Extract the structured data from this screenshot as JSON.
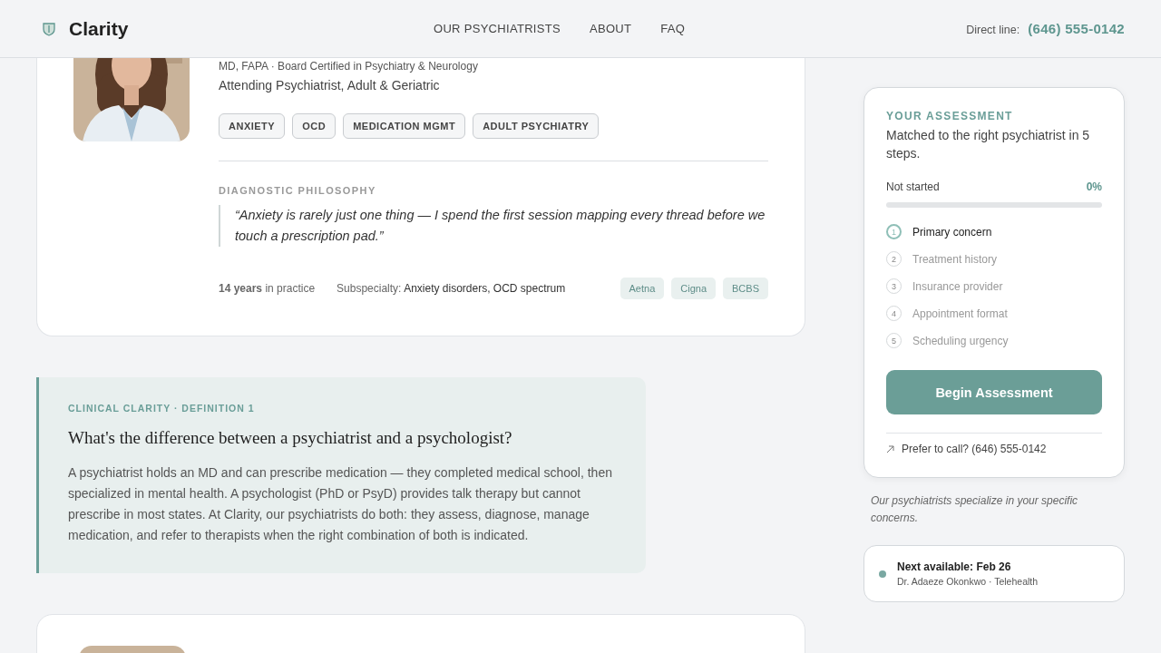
{
  "header": {
    "brand": "Clarity",
    "nav": [
      {
        "label": "OUR PSYCHIATRISTS"
      },
      {
        "label": "ABOUT"
      },
      {
        "label": "FAQ"
      }
    ],
    "direct_line_label": "Direct line:",
    "direct_line_phone": "(646) 555-0142"
  },
  "doctor": {
    "photo": {
      "kind": "picture"
    },
    "credentials": "MD, FAPA · Board Certified in Psychiatry & Neurology",
    "role": "Attending Psychiatrist, Adult & Geriatric",
    "tags": [
      "ANXIETY",
      "OCD",
      "MEDICATION MGMT",
      "ADULT PSYCHIATRY"
    ],
    "philosophy_label": "DIAGNOSTIC PHILOSOPHY",
    "quote": "“Anxiety is rarely just one thing — I spend the first session mapping every thread before we touch a prescription pad.”",
    "experience": "**14 years** in practice",
    "subspecialty_label": "Subspecialty:",
    "subspecialty": "Anxiety disorders, OCD spectrum",
    "insurers": [
      "Aetna",
      "Cigna",
      "BCBS"
    ]
  },
  "definition": {
    "eyebrow": "CLINICAL CLARITY · DEFINITION 1",
    "question": "What's the difference between a psychiatrist and a psychologist?",
    "answer": "A psychiatrist holds an MD and can prescribe medication — they completed medical school, then specialized in mental health. A psychologist (PhD or PsyD) provides talk therapy but cannot prescribe in most states. At Clarity, our psychiatrists do both: they assess, diagnose, manage medication, and refer to therapists when the right combination of both is indicated."
  },
  "next_doctor": {
    "photo": {
      "kind": "picture"
    }
  },
  "assessment": {
    "eyebrow": "YOUR ASSESSMENT",
    "subtitle": "Matched to the right psychiatrist in 5 steps.",
    "status": "Not started",
    "percent": "0%",
    "level": 0,
    "steps": [
      {
        "number": "1",
        "label": "Primary concern",
        "active": true
      },
      {
        "number": "2",
        "label": "Treatment history",
        "active": false
      },
      {
        "number": "3",
        "label": "Insurance provider",
        "active": false
      },
      {
        "number": "4",
        "label": "Appointment format",
        "active": false
      },
      {
        "number": "5",
        "label": "Scheduling urgency",
        "active": false
      }
    ],
    "button": "Begin Assessment",
    "call_link": "Prefer to call? (646) 555-0142"
  },
  "note": "Our psychiatrists specialize in your specific concerns.",
  "availability": {
    "title": "Next available: Feb 26",
    "detail": "Dr. Adaeze Okonkwo · Telehealth"
  }
}
